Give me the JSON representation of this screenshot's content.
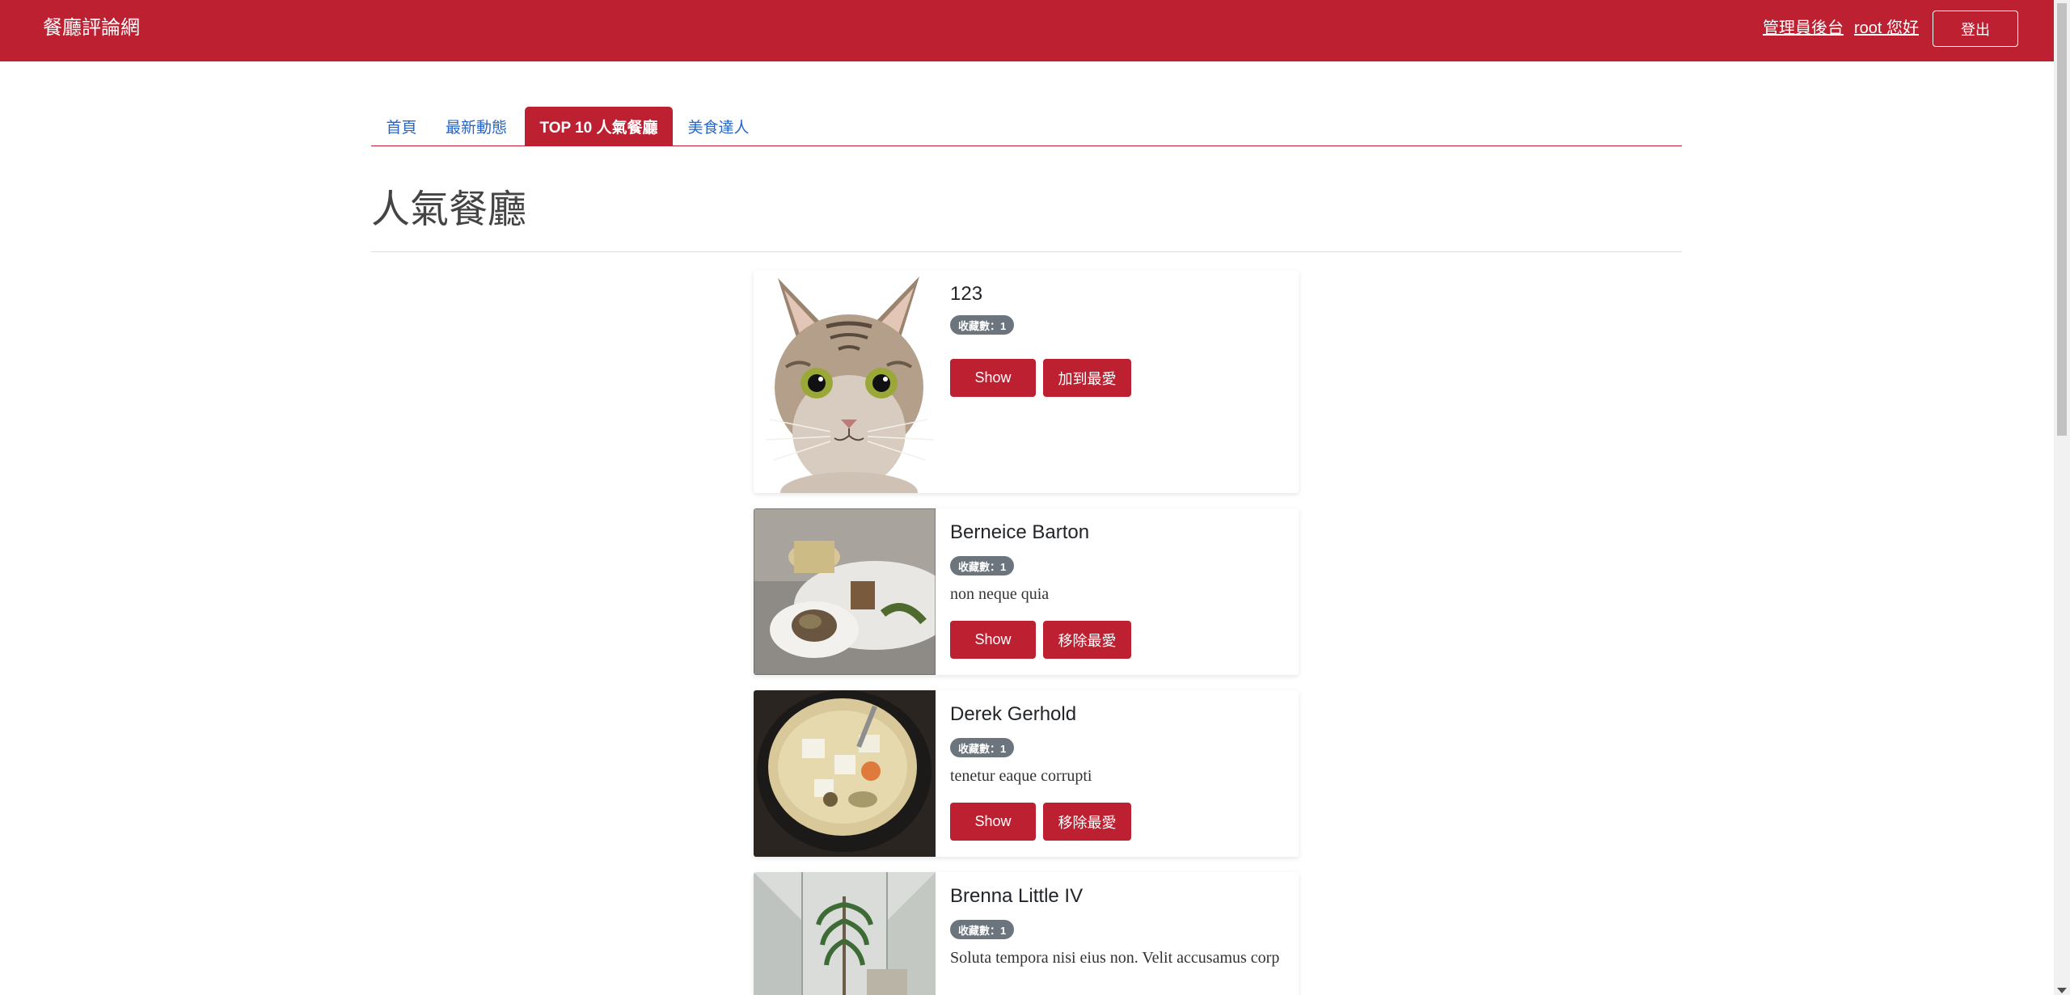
{
  "navbar": {
    "brand": "餐廳評論網",
    "admin_link": "管理員後台",
    "user_link": "root 您好",
    "logout_label": "登出"
  },
  "tabs": [
    {
      "label": "首頁",
      "active": false
    },
    {
      "label": "最新動態",
      "active": false
    },
    {
      "label": "TOP 10 人氣餐廳",
      "active": true
    },
    {
      "label": "美食達人",
      "active": false
    }
  ],
  "page": {
    "title": "人氣餐廳"
  },
  "restaurants": [
    {
      "name": "123",
      "favorite_count": "收藏數：1",
      "description": "",
      "show_label": "Show",
      "favorite_action": "加到最愛",
      "image": "cat"
    },
    {
      "name": "Berneice Barton",
      "favorite_count": "收藏數：1",
      "description": "non neque quia",
      "show_label": "Show",
      "favorite_action": "移除最愛",
      "image": "plated-dish"
    },
    {
      "name": "Derek Gerhold",
      "favorite_count": "收藏數：1",
      "description": "tenetur eaque corrupti",
      "show_label": "Show",
      "favorite_action": "移除最愛",
      "image": "tofu-stew"
    },
    {
      "name": "Brenna Little IV",
      "favorite_count": "收藏數：1",
      "description": "Soluta tempora nisi eius non. Velit accusamus corp",
      "show_label": "Show",
      "favorite_action": "移除最愛",
      "image": "atrium-plants"
    }
  ],
  "colors": {
    "brand_red": "#bd2031",
    "link_blue": "#2566c8",
    "badge_gray": "#6c757d"
  }
}
